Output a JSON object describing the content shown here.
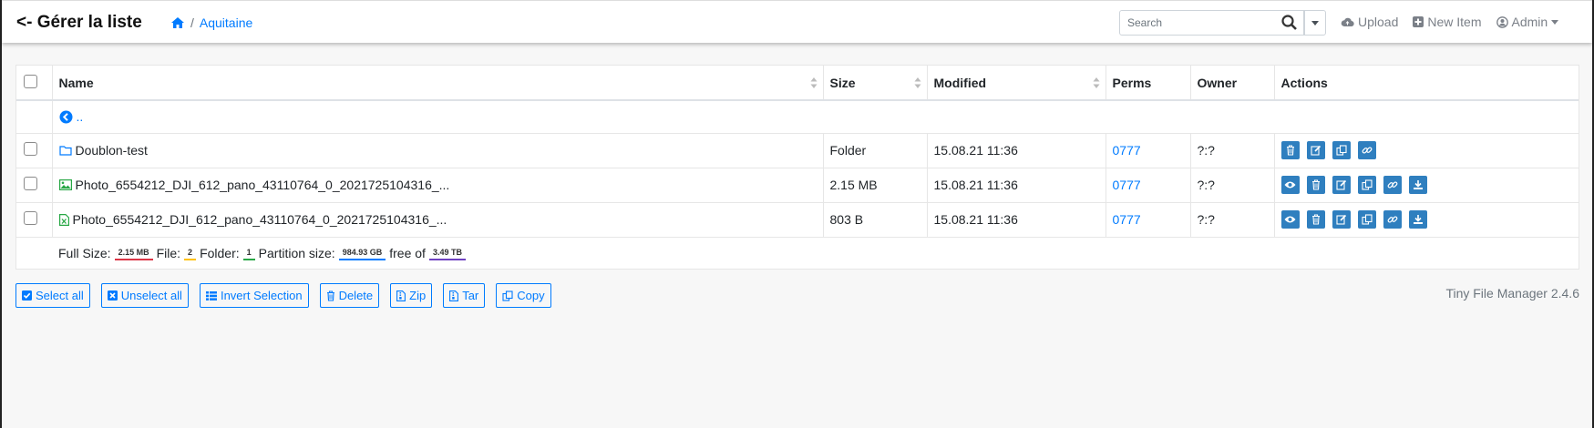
{
  "navbar": {
    "title": "<- Gérer la liste",
    "breadcrumb": {
      "separator": "/",
      "current": "Aquitaine"
    },
    "search": {
      "placeholder": "Search"
    },
    "links": {
      "upload": "Upload",
      "new_item": "New Item",
      "admin": "Admin"
    }
  },
  "table": {
    "headers": {
      "name": "Name",
      "size": "Size",
      "modified": "Modified",
      "perms": "Perms",
      "owner": "Owner",
      "actions": "Actions"
    },
    "up_label": "..",
    "rows": [
      {
        "name": "Doublon-test",
        "size": "Folder",
        "modified": "15.08.21 11:36",
        "perms": "0777",
        "owner": "?:?",
        "type": "folder"
      },
      {
        "name": "Photo_6554212_DJI_612_pano_43110764_0_2021725104316_...",
        "size": "2.15 MB",
        "modified": "15.08.21 11:36",
        "perms": "0777",
        "owner": "?:?",
        "type": "image"
      },
      {
        "name": "Photo_6554212_DJI_612_pano_43110764_0_2021725104316_...",
        "size": "803 B",
        "modified": "15.08.21 11:36",
        "perms": "0777",
        "owner": "?:?",
        "type": "sheet"
      }
    ],
    "footer": {
      "full_size_label": "Full Size:",
      "full_size": "2.15 MB",
      "file_label": "File:",
      "file_count": "2",
      "folder_label": "Folder:",
      "folder_count": "1",
      "partition_label": "Partition size:",
      "partition_free": "984.93 GB",
      "free_of_label": "free of",
      "partition_total": "3.49 TB"
    }
  },
  "bulk_buttons": {
    "select_all": "Select all",
    "unselect_all": "Unselect all",
    "invert": "Invert Selection",
    "delete": "Delete",
    "zip": "Zip",
    "tar": "Tar",
    "copy": "Copy"
  },
  "version": "Tiny File Manager 2.4.6",
  "colors": {
    "link": "#007bff",
    "action": "#2f7fbf",
    "underline_red": "#dc3545",
    "underline_yellow": "#ffc107",
    "underline_green": "#28a745",
    "underline_blue": "#007bff",
    "underline_purple": "#6f42c1"
  }
}
